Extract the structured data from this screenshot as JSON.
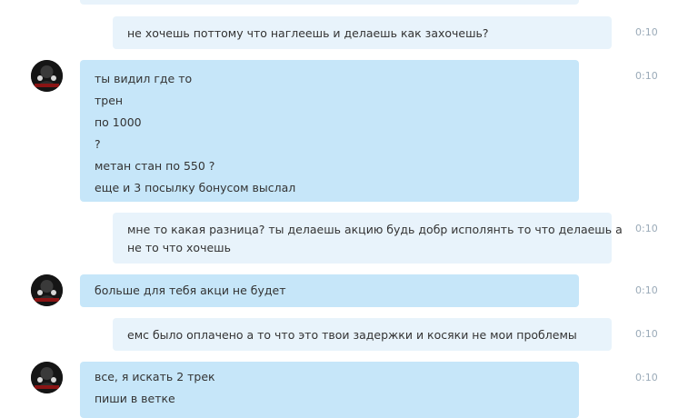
{
  "messages": [
    {
      "from": "me",
      "lines": [
        "не хочешь поттому что наглеешь и делаешь как захочешь?"
      ],
      "time": "0:10"
    },
    {
      "from": "them",
      "lines": [
        "ты видил где то",
        "трен",
        "по 1000",
        "?",
        "метан стан по 550 ?",
        "еще и 3 посылку бонусом выслал"
      ],
      "time": "0:10"
    },
    {
      "from": "me",
      "lines": [
        "мне то какая разница? ты делаешь акцию будь добр исполянть то что делаешь а",
        "не то что хочешь"
      ],
      "time": "0:10"
    },
    {
      "from": "them",
      "lines": [
        "больше для тебя акци не будет"
      ],
      "time": "0:10"
    },
    {
      "from": "me",
      "lines": [
        "емс было оплачено а то что это твои задержки и косяки не мои проблемы"
      ],
      "time": "0:10"
    },
    {
      "from": "them",
      "lines": [
        "все, я искать 2 трек",
        "пиши в ветке"
      ],
      "time": "0:10"
    }
  ],
  "colors": {
    "incoming_bubble": "#c6e6f9",
    "outgoing_bubble": "#e8f3fb",
    "timestamp": "#9aaab8"
  }
}
